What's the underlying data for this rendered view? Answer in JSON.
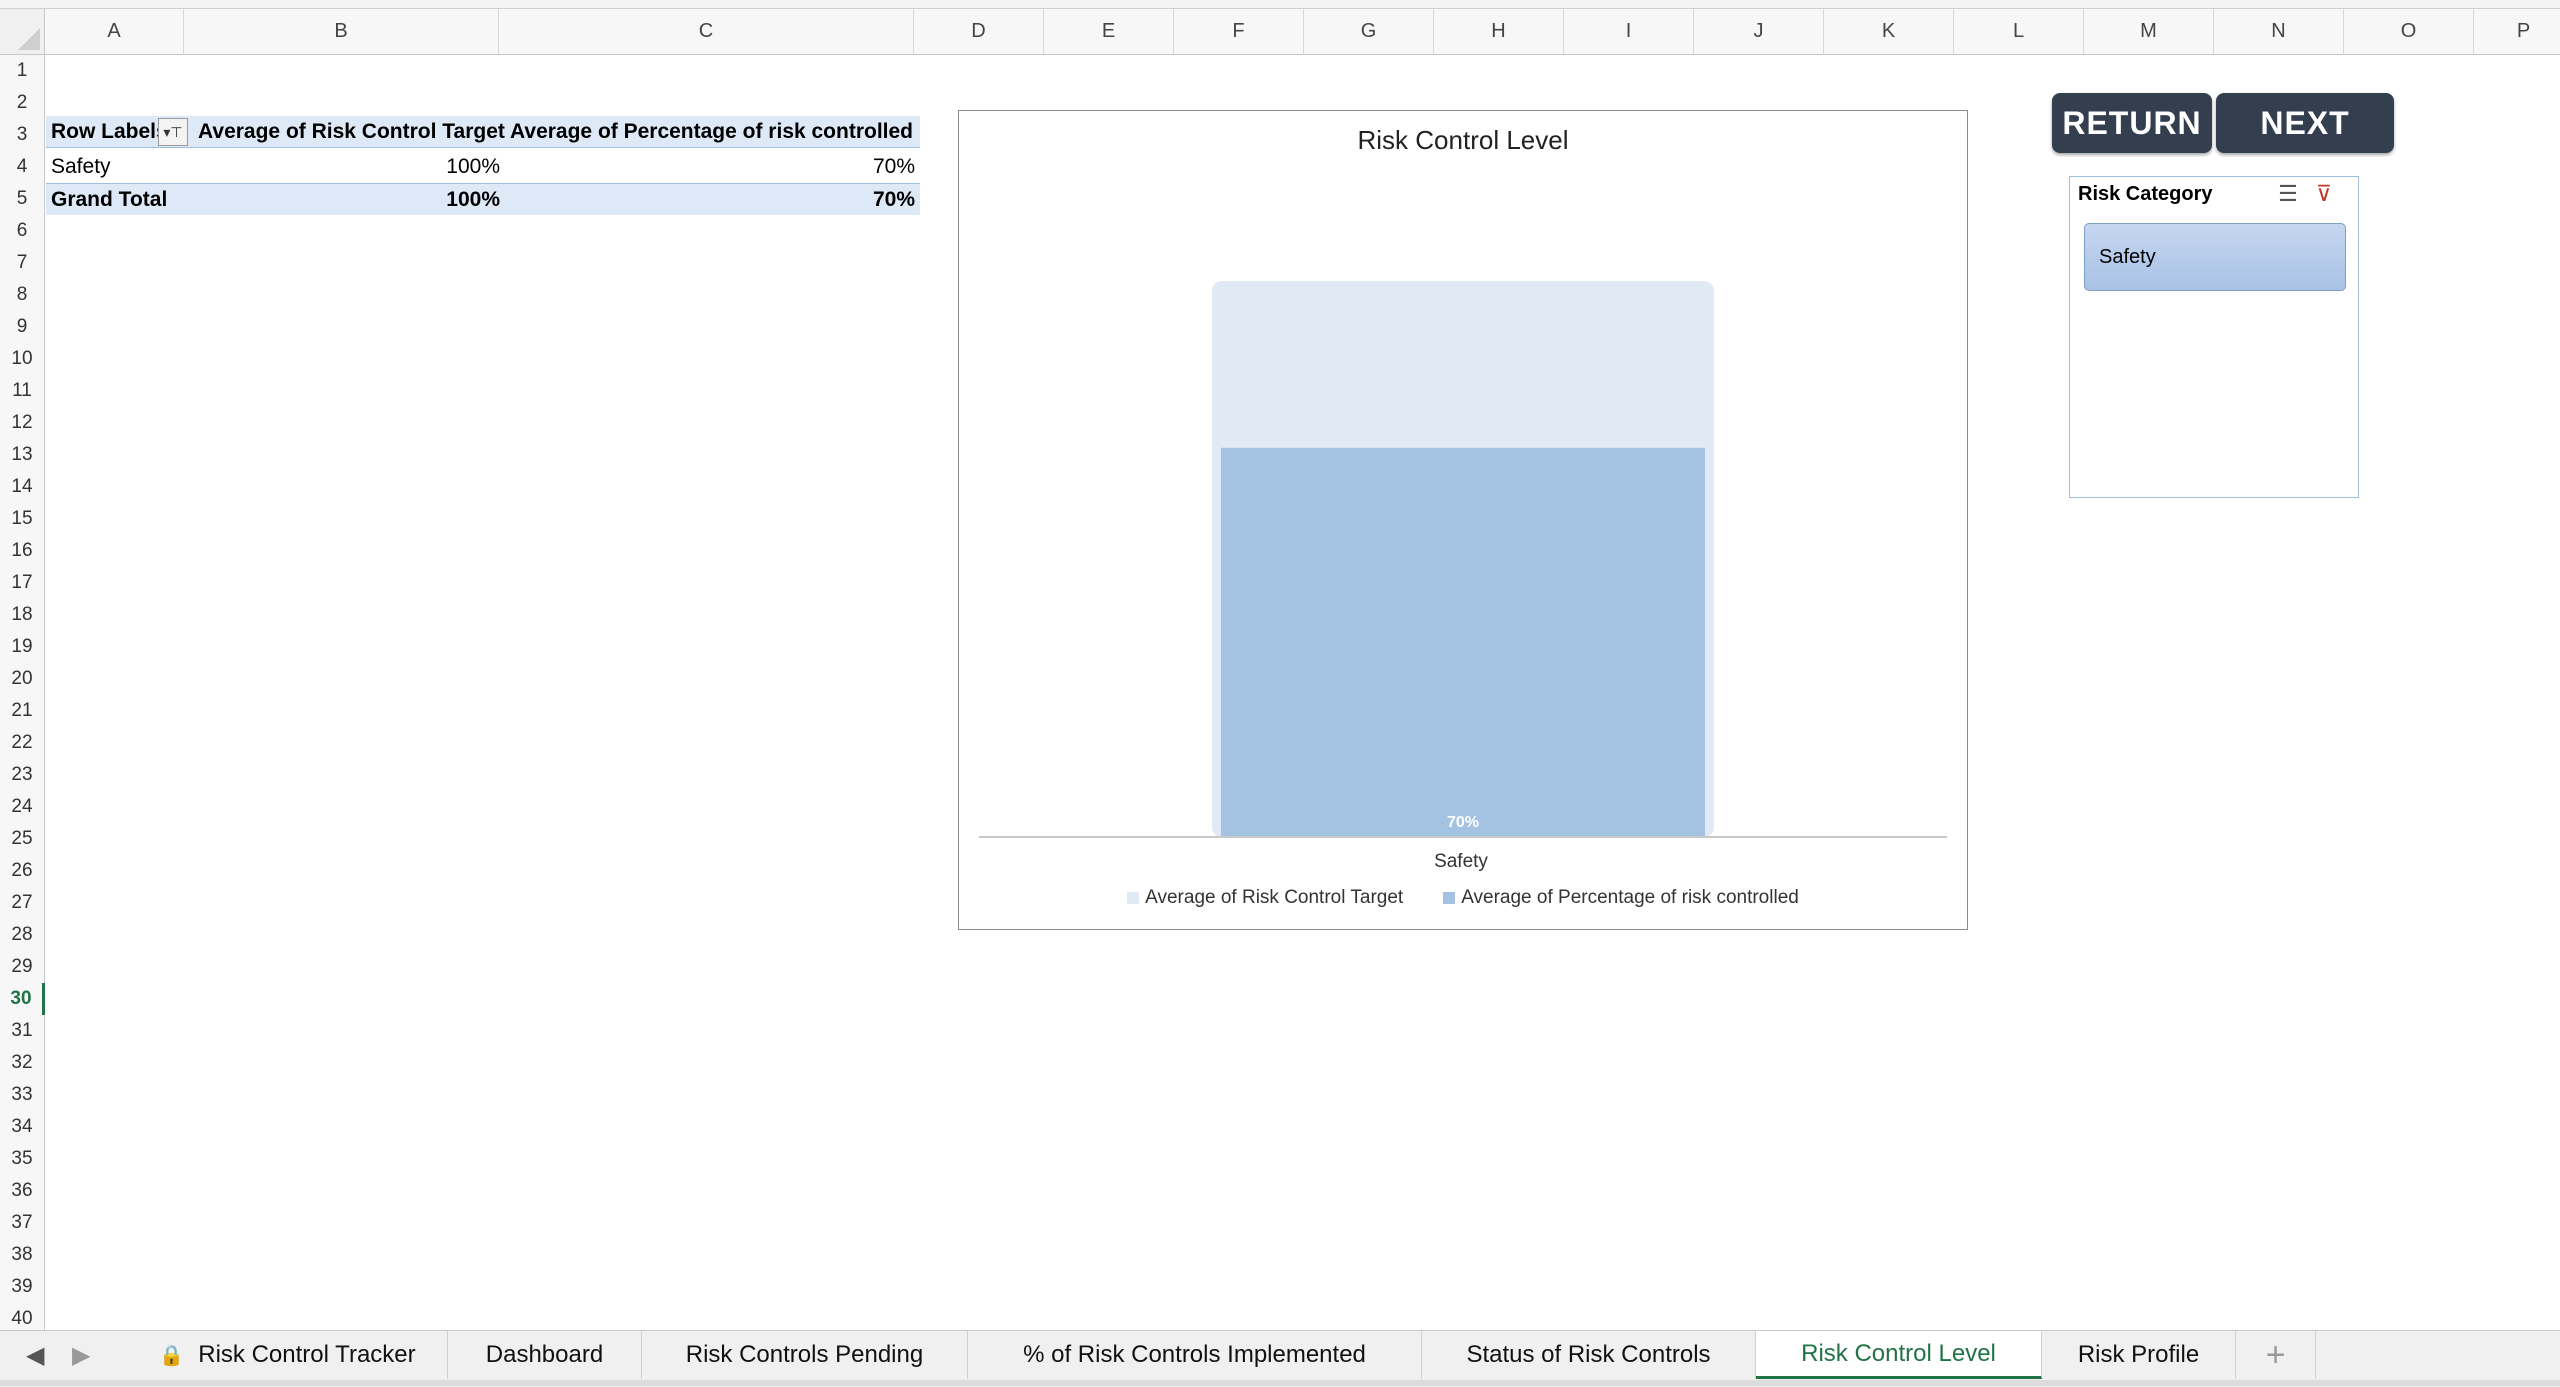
{
  "columns": [
    "A",
    "B",
    "C",
    "D",
    "E",
    "F",
    "G",
    "H",
    "I",
    "J",
    "K",
    "L",
    "M",
    "N",
    "O",
    "P"
  ],
  "rows": [
    "1",
    "2",
    "3",
    "4",
    "5",
    "6",
    "7",
    "8",
    "9",
    "10",
    "11",
    "12",
    "13",
    "14",
    "15",
    "16",
    "17",
    "18",
    "19",
    "20",
    "21",
    "22",
    "23",
    "24",
    "25",
    "26",
    "27",
    "28",
    "29",
    "30",
    "31",
    "32",
    "33",
    "34",
    "35",
    "36",
    "37",
    "38",
    "39",
    "40"
  ],
  "active_row": "30",
  "pivot": {
    "headers": [
      "Row Labels",
      "Average of Risk Control Target",
      "Average of Percentage of risk controlled"
    ],
    "rows": [
      {
        "label": "Safety",
        "target": "100%",
        "controlled": "70%"
      },
      {
        "label": "Grand Total",
        "target": "100%",
        "controlled": "70%"
      }
    ]
  },
  "chart_data": {
    "type": "bar",
    "title": "Risk Control Level",
    "categories": [
      "Safety"
    ],
    "series": [
      {
        "name": "Average of Risk Control Target",
        "values": [
          1.0
        ],
        "color": "#e1e9f4"
      },
      {
        "name": "Average of Percentage of risk controlled",
        "values": [
          0.7
        ],
        "color": "#a4c2e2"
      }
    ],
    "data_labels": [
      "70%"
    ],
    "ylim": [
      0,
      1
    ],
    "legend": "bottom",
    "grid": false
  },
  "buttons": {
    "return_label": "RETURN",
    "next_label": "NEXT"
  },
  "slicer": {
    "title": "Risk Category",
    "items": [
      "Safety"
    ]
  },
  "tabs": [
    {
      "label": "Risk Control Tracker",
      "locked": true
    },
    {
      "label": "Dashboard"
    },
    {
      "label": "Risk Controls Pending"
    },
    {
      "label": "% of Risk Controls Implemented"
    },
    {
      "label": "Status of Risk Controls"
    },
    {
      "label": "Risk Control Level",
      "active": true
    },
    {
      "label": "Risk Profile"
    }
  ],
  "add_sheet_label": "+"
}
